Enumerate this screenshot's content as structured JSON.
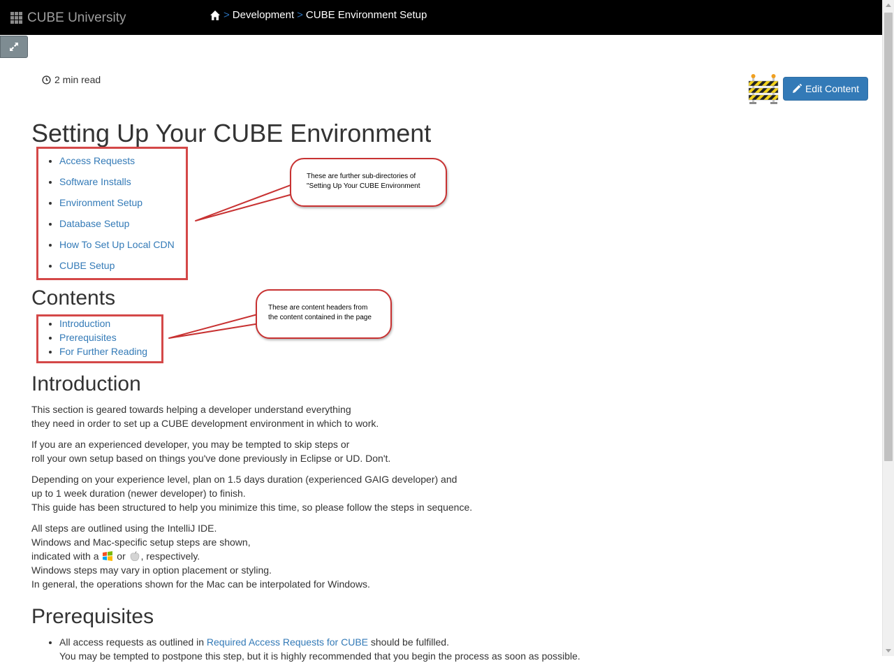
{
  "navbar": {
    "brand": "CUBE University",
    "breadcrumb": {
      "separator": ">",
      "items": [
        "Development",
        "CUBE Environment Setup"
      ]
    }
  },
  "article": {
    "read_time": "2 min read",
    "edit_button": "Edit Content",
    "title": "Setting Up Your CUBE Environment",
    "subdirectories": [
      "Access Requests",
      "Software Installs",
      "Environment Setup",
      "Database Setup",
      "How To Set Up Local CDN",
      "CUBE Setup"
    ],
    "contents_heading": "Contents",
    "contents": [
      "Introduction",
      "Prerequisites",
      "For Further Reading"
    ],
    "introduction": {
      "heading": "Introduction",
      "p1": [
        "This section is geared towards helping a developer understand everything",
        "they need in order to set up a CUBE development environment in which to work."
      ],
      "p2": [
        "If you are an experienced developer, you may be tempted to skip steps or",
        "roll your own setup based on things you've done previously in Eclipse or UD. Don't."
      ],
      "p3": [
        "Depending on your experience level, plan on 1.5 days duration (experienced GAIG developer) and",
        "up to 1 week duration (newer developer) to finish.",
        "This guide has been structured to help you minimize this time, so please follow the steps in sequence."
      ],
      "p4": {
        "line1": "All steps are outlined using the IntelliJ IDE.",
        "line2": "Windows and Mac-specific setup steps are shown,",
        "line3_pre": "indicated with a ",
        "line3_mid": " or ",
        "line3_post": ", respectively.",
        "line4": "Windows steps may vary in option placement or styling.",
        "line5": "In general, the operations shown for the Mac can be interpolated for Windows."
      }
    },
    "prerequisites": {
      "heading": "Prerequisites",
      "item1_pre": "All access requests as outlined in ",
      "item1_link": "Required Access Requests for CUBE",
      "item1_post": " should be fulfilled.",
      "item1_cont": "You may be tempted to postpone this step, but it is highly recommended that you begin the process as soon as possible."
    }
  },
  "annotations": {
    "subdirs_callout": [
      "These are further sub-directories of",
      "\"Setting Up Your CUBE Environment"
    ],
    "toc_callout": [
      "These are content headers from",
      "the content contained in the page"
    ]
  },
  "colors": {
    "navbar_bg": "#000000",
    "link": "#337ab7",
    "edit_button_bg": "#337ab7",
    "annotation_red": "#d44848"
  },
  "icons": [
    "apps-grid-icon",
    "home-icon",
    "expand-icon",
    "clock-icon",
    "construction-icon",
    "pencil-icon",
    "windows-icon",
    "apple-icon"
  ]
}
